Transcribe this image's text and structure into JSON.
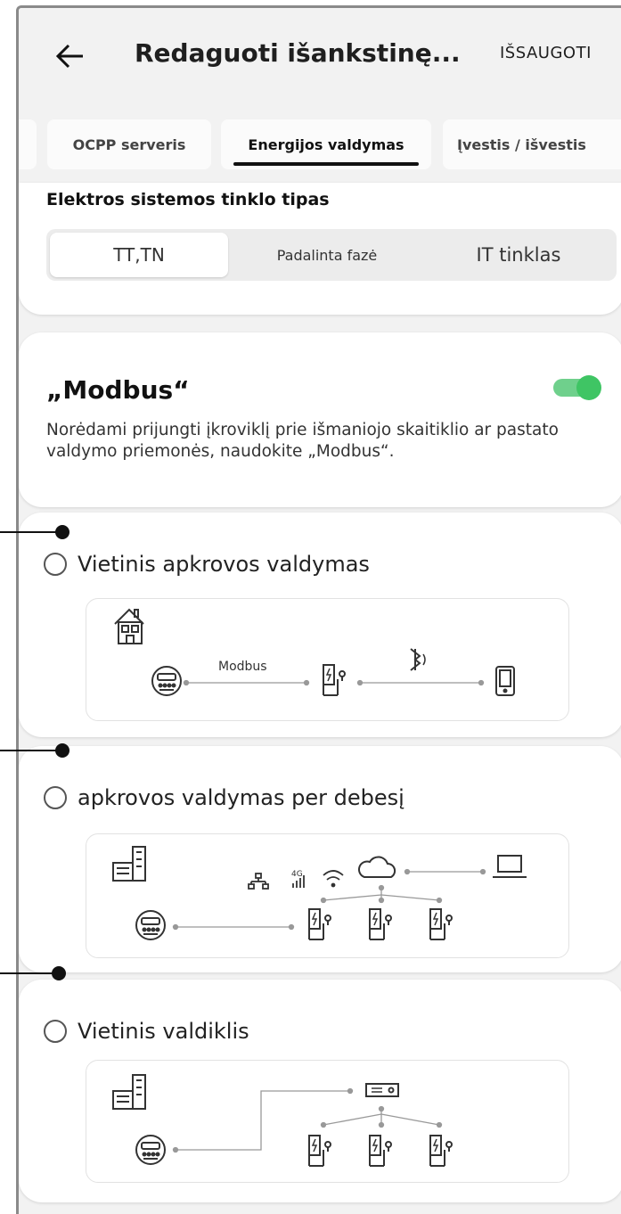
{
  "header": {
    "title": "Redaguoti išankstinę...",
    "save_label": "IŠSAUGOTI"
  },
  "tabs": [
    {
      "label": "OCPP serveris",
      "active": false
    },
    {
      "label": "Energijos valdymas",
      "active": true
    },
    {
      "label": "Įvestis / išvestis",
      "active": false
    }
  ],
  "grid": {
    "title": "Elektros sistemos tinklo tipas",
    "options": [
      "TT,TN",
      "Padalinta fazė",
      "IT tinklas"
    ],
    "selected": "TT,TN"
  },
  "modbus": {
    "title": "„Modbus“",
    "description": "Norėdami prijungti įkroviklį prie išmaniojo skaitiklio ar pastato valdymo priemonės, naudokite „Modbus“.",
    "enabled": true
  },
  "options": [
    {
      "label": "Vietinis apkrovos valdymas",
      "selected": false,
      "diagram_label": "Modbus"
    },
    {
      "label": "apkrovos valdymas per debesį",
      "selected": false,
      "network_label": "4G"
    },
    {
      "label": "Vietinis valdiklis",
      "selected": false
    }
  ],
  "colors": {
    "toggle_on": "#3fc564",
    "background": "#f2f2f2",
    "card": "#ffffff"
  }
}
